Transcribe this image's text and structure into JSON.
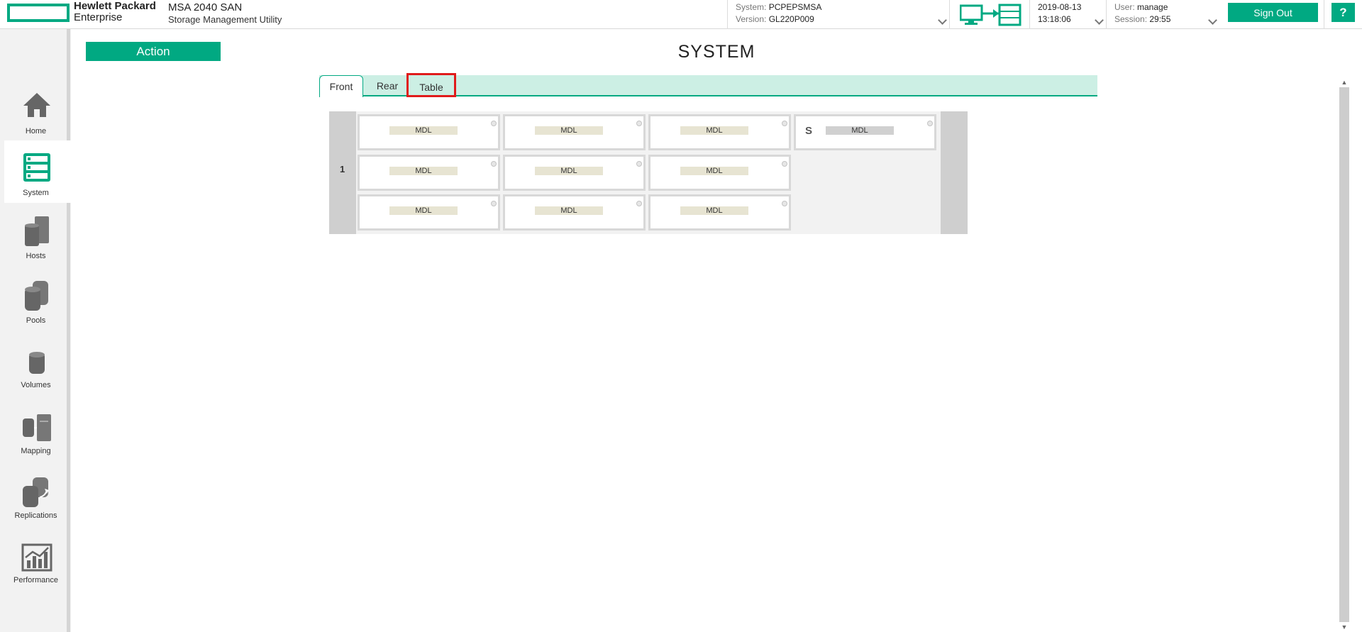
{
  "header": {
    "brand_line1": "Hewlett Packard",
    "brand_line2": "Enterprise",
    "product_title": "MSA 2040 SAN",
    "product_subtitle": "Storage Management Utility",
    "system_label": "System:",
    "system_value": "PCPEPSMSA",
    "version_label": "Version:",
    "version_value": "GL220P009",
    "date": "2019-08-13",
    "time": "13:18:06",
    "user_label": "User:",
    "user_value": "manage",
    "session_label": "Session:",
    "session_value": "29:55",
    "sign_out_label": "Sign Out",
    "help_label": "?"
  },
  "sidebar": {
    "items": [
      {
        "label": "Home",
        "icon": "home-icon"
      },
      {
        "label": "System",
        "icon": "system-icon",
        "active": true
      },
      {
        "label": "Hosts",
        "icon": "hosts-icon"
      },
      {
        "label": "Pools",
        "icon": "pools-icon"
      },
      {
        "label": "Volumes",
        "icon": "volumes-icon"
      },
      {
        "label": "Mapping",
        "icon": "mapping-icon"
      },
      {
        "label": "Replications",
        "icon": "replications-icon"
      },
      {
        "label": "Performance",
        "icon": "performance-icon"
      }
    ]
  },
  "main": {
    "action_label": "Action",
    "page_title": "SYSTEM",
    "tabs": [
      {
        "label": "Front",
        "selected": true
      },
      {
        "label": "Rear"
      },
      {
        "label": "Table",
        "highlighted": true
      }
    ],
    "enclosure": {
      "number": "1",
      "spare_marker": "S",
      "drives": [
        {
          "label": "MDL"
        },
        {
          "label": "MDL"
        },
        {
          "label": "MDL"
        },
        {
          "label": "MDL",
          "spare": true
        },
        {
          "label": "MDL"
        },
        {
          "label": "MDL"
        },
        {
          "label": "MDL"
        },
        {
          "label": "MDL"
        },
        {
          "label": "MDL"
        },
        {
          "label": "MDL"
        }
      ]
    }
  },
  "colors": {
    "accent": "#01a982",
    "tab_bar": "#ccefe4",
    "highlight": "#e01b1b"
  }
}
